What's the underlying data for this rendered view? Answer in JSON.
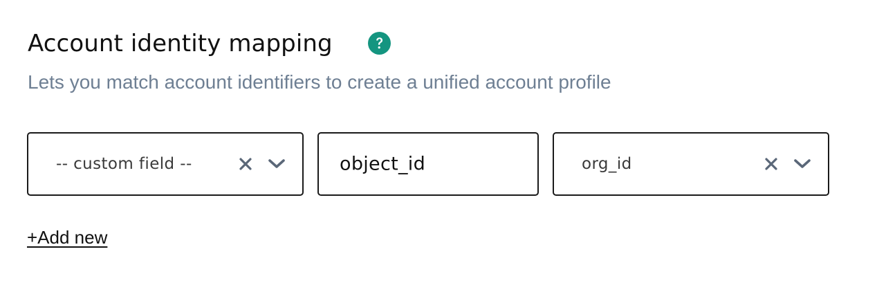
{
  "section": {
    "title": "Account identity mapping",
    "subtitle": "Lets you match account identifiers to create a unified account profile",
    "help_icon": "question-circle-icon",
    "colors": {
      "help_icon_bg": "#149580",
      "subtitle_text": "#6e7f93",
      "icon_gray": "#5a6778",
      "border": "#1a1a1a"
    }
  },
  "mapping_row": {
    "left_select": {
      "value": "-- custom field --",
      "clear_icon": "close-icon",
      "dropdown_icon": "chevron-down-icon"
    },
    "middle_input": {
      "value": "object_id"
    },
    "right_select": {
      "value": "org_id",
      "clear_icon": "close-icon",
      "dropdown_icon": "chevron-down-icon"
    }
  },
  "actions": {
    "add_new_label": "+Add new"
  }
}
